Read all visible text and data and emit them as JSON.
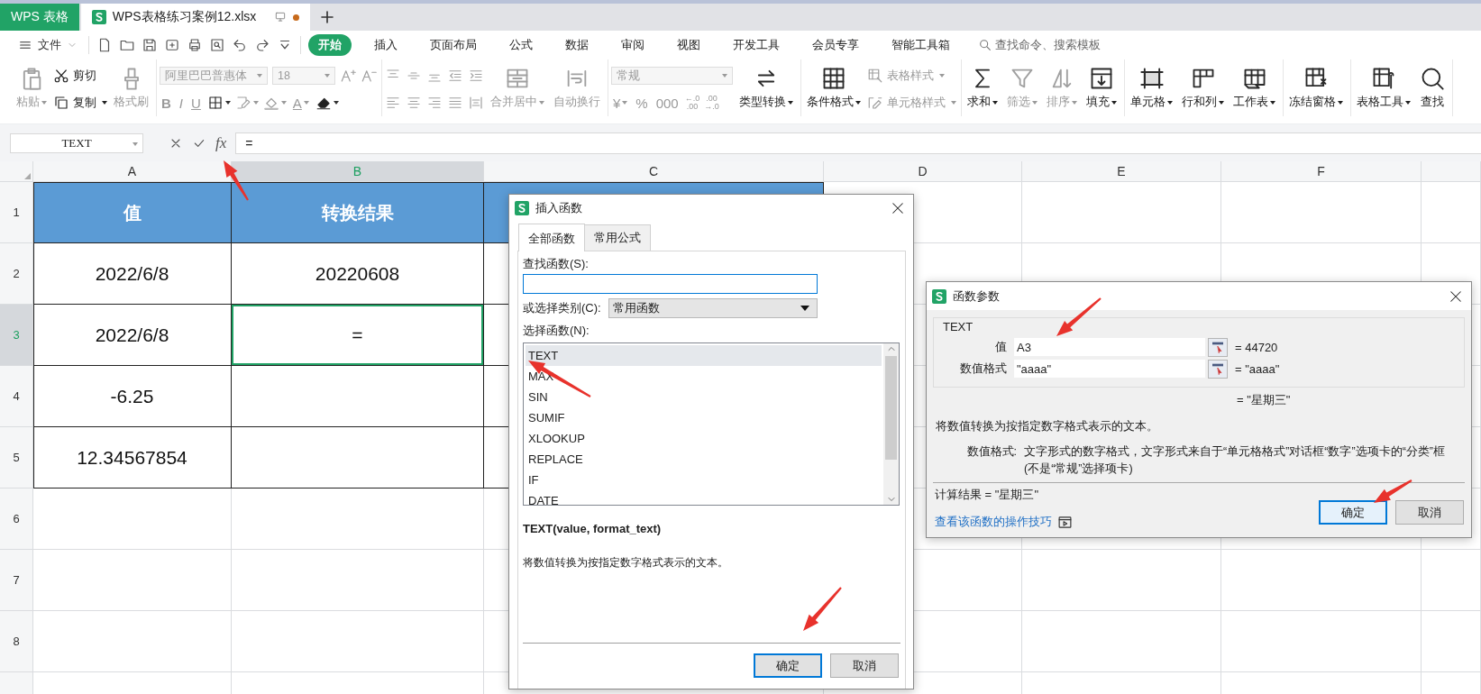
{
  "app_tabs": [
    {
      "label": "WPS 表格",
      "kind": "home",
      "selected": false
    },
    {
      "label": "WPS表格练习案例12.xlsx",
      "kind": "document",
      "selected": true,
      "unsaved": true
    }
  ],
  "menu": {
    "file": "文件",
    "tabs": [
      {
        "label": "开始",
        "selected": true
      },
      {
        "label": "插入",
        "selected": false
      },
      {
        "label": "页面布局",
        "selected": false
      },
      {
        "label": "公式",
        "selected": false
      },
      {
        "label": "数据",
        "selected": false
      },
      {
        "label": "审阅",
        "selected": false
      },
      {
        "label": "视图",
        "selected": false
      },
      {
        "label": "开发工具",
        "selected": false
      },
      {
        "label": "会员专享",
        "selected": false
      },
      {
        "label": "智能工具箱",
        "selected": false
      }
    ],
    "search_placeholder": "查找命令、搜索模板"
  },
  "ribbon": {
    "groups": [
      {
        "items": [
          {
            "kind": "large",
            "label": "粘贴",
            "disabled": true,
            "dropdown": true
          },
          {
            "kind": "stack",
            "top": [
              {
                "kind": "small",
                "label": "剪切",
                "disabled": false
              }
            ],
            "bottom": [
              {
                "kind": "small",
                "label": "复制",
                "disabled": false,
                "dropdown": true
              }
            ]
          },
          {
            "kind": "large",
            "label": "格式刷",
            "disabled": true
          }
        ]
      },
      {
        "items": [
          {
            "kind": "stack",
            "top": [
              {
                "kind": "combo",
                "value": "阿里巴巴普惠体",
                "disabled": true
              },
              {
                "kind": "combo",
                "value": "18",
                "disabled": true
              },
              {
                "kind": "icon",
                "disabled": true
              },
              {
                "kind": "icon",
                "disabled": true
              }
            ],
            "bottom": [
              {
                "kind": "glyph",
                "label": "B",
                "disabled": true
              },
              {
                "kind": "glyph",
                "label": "I",
                "disabled": true
              },
              {
                "kind": "glyph",
                "label": "U",
                "disabled": true
              },
              {
                "kind": "icon",
                "disabled": false,
                "dropdown": true
              },
              {
                "kind": "icon",
                "disabled": true,
                "dropdown": true
              },
              {
                "kind": "icon",
                "disabled": true,
                "dropdown": true
              },
              {
                "kind": "glyph",
                "label": "A",
                "disabled": true,
                "dropdown": true
              },
              {
                "kind": "icon",
                "disabled": false,
                "dropdown": true
              }
            ]
          }
        ]
      },
      {
        "items": [
          {
            "kind": "stack",
            "top": [
              {
                "kind": "icon",
                "disabled": true
              },
              {
                "kind": "icon",
                "disabled": true
              },
              {
                "kind": "icon",
                "disabled": true
              },
              {
                "kind": "icon",
                "disabled": true
              },
              {
                "kind": "icon",
                "disabled": true
              }
            ],
            "bottom": [
              {
                "kind": "icon",
                "disabled": true
              },
              {
                "kind": "icon",
                "disabled": true
              },
              {
                "kind": "icon",
                "disabled": true
              },
              {
                "kind": "icon",
                "disabled": true
              },
              {
                "kind": "icon",
                "disabled": true
              }
            ]
          },
          {
            "kind": "large",
            "label": "合并居中",
            "disabled": true,
            "dropdown": true
          },
          {
            "kind": "large",
            "label": "自动换行",
            "disabled": true
          }
        ]
      },
      {
        "items": [
          {
            "kind": "stack",
            "top": [
              {
                "kind": "combo",
                "value": "常规",
                "disabled": true
              }
            ],
            "bottom": [
              {
                "kind": "glyph",
                "label": "¥",
                "disabled": true,
                "dropdown": true
              },
              {
                "kind": "glyph",
                "label": "%",
                "disabled": true
              },
              {
                "kind": "glyph",
                "label": "000",
                "disabled": true
              },
              {
                "kind": "glyph2",
                "top": "←.0",
                "bottom": ".00",
                "disabled": true
              },
              {
                "kind": "glyph2",
                "top": ".00",
                "bottom": "→.0",
                "disabled": true
              }
            ]
          },
          {
            "kind": "large",
            "label": "类型转换",
            "disabled": false,
            "dropdown": true
          }
        ]
      },
      {
        "items": [
          {
            "kind": "large",
            "label": "条件格式",
            "disabled": false,
            "dropdown": true
          },
          {
            "kind": "stack",
            "top": [
              {
                "kind": "small",
                "label": "表格样式",
                "disabled": true,
                "dropdown": true
              }
            ],
            "bottom": [
              {
                "kind": "small",
                "label": "单元格样式",
                "disabled": true,
                "dropdown": true
              }
            ]
          }
        ]
      },
      {
        "items": [
          {
            "kind": "large",
            "label": "求和",
            "disabled": false,
            "dropdown": true
          },
          {
            "kind": "large",
            "label": "筛选",
            "disabled": true,
            "dropdown": true
          },
          {
            "kind": "large",
            "label": "排序",
            "disabled": true,
            "dropdown": true
          },
          {
            "kind": "large",
            "label": "填充",
            "disabled": false,
            "dropdown": true
          }
        ]
      },
      {
        "items": [
          {
            "kind": "large",
            "label": "单元格",
            "disabled": false,
            "dropdown": true
          },
          {
            "kind": "large",
            "label": "行和列",
            "disabled": false,
            "dropdown": true
          },
          {
            "kind": "large",
            "label": "工作表",
            "disabled": false,
            "dropdown": true
          }
        ]
      },
      {
        "items": [
          {
            "kind": "large",
            "label": "冻结窗格",
            "disabled": false,
            "dropdown": true
          }
        ]
      },
      {
        "items": [
          {
            "kind": "large",
            "label": "表格工具",
            "disabled": false,
            "dropdown": true
          },
          {
            "kind": "large",
            "label": "查找",
            "disabled": false
          }
        ]
      }
    ]
  },
  "formula_bar": {
    "name_box": "TEXT",
    "function_button": "fx",
    "formula": "="
  },
  "sheet": {
    "columns": [
      {
        "label": "A",
        "selected": false
      },
      {
        "label": "B",
        "selected": true
      },
      {
        "label": "C",
        "selected": false
      },
      {
        "label": "D",
        "selected": false
      },
      {
        "label": "E",
        "selected": false
      },
      {
        "label": "F",
        "selected": false
      }
    ],
    "rows": [
      {
        "header": "1",
        "selected": false,
        "kind": "table-header",
        "cells": [
          {
            "text": "值",
            "selected": false
          },
          {
            "text": "转换结果",
            "selected": false
          },
          {
            "text": "",
            "selected": false
          }
        ]
      },
      {
        "header": "2",
        "selected": false,
        "kind": "table-row",
        "cells": [
          {
            "text": "2022/6/8",
            "selected": false
          },
          {
            "text": "20220608",
            "selected": false
          },
          {
            "text": "",
            "selected": false
          }
        ]
      },
      {
        "header": "3",
        "selected": true,
        "kind": "table-row",
        "cells": [
          {
            "text": "2022/6/8",
            "selected": false
          },
          {
            "text": "=",
            "selected": true
          },
          {
            "text": "",
            "selected": false
          }
        ]
      },
      {
        "header": "4",
        "selected": false,
        "kind": "table-row",
        "cells": [
          {
            "text": "-6.25",
            "selected": false
          },
          {
            "text": "",
            "selected": false
          },
          {
            "text": "",
            "selected": false
          }
        ]
      },
      {
        "header": "5",
        "selected": false,
        "kind": "table-row",
        "cells": [
          {
            "text": "12.34567854",
            "selected": false
          },
          {
            "text": "",
            "selected": false
          },
          {
            "text": "",
            "selected": false
          }
        ]
      },
      {
        "header": "6",
        "selected": false,
        "kind": "empty"
      },
      {
        "header": "7",
        "selected": false,
        "kind": "empty"
      },
      {
        "header": "8",
        "selected": false,
        "kind": "empty"
      }
    ]
  },
  "insert_function_dialog": {
    "title": "插入函数",
    "tabs": [
      {
        "label": "全部函数",
        "selected": true
      },
      {
        "label": "常用公式",
        "selected": false
      }
    ],
    "search_label": "查找函数(S):",
    "category_label": "或选择类别(C):",
    "category": "常用函数",
    "list_label": "选择函数(N):",
    "functions": [
      {
        "name": "TEXT",
        "selected": true
      },
      {
        "name": "MAX",
        "selected": false
      },
      {
        "name": "SIN",
        "selected": false
      },
      {
        "name": "SUMIF",
        "selected": false
      },
      {
        "name": "XLOOKUP",
        "selected": false
      },
      {
        "name": "REPLACE",
        "selected": false
      },
      {
        "name": "IF",
        "selected": false
      },
      {
        "name": "DATE",
        "selected": false
      }
    ],
    "signature": "TEXT(value, format_text)",
    "description": "将数值转换为按指定数字格式表示的文本。",
    "buttons": [
      {
        "label": "确定",
        "default": true
      },
      {
        "label": "取消",
        "default": false
      }
    ]
  },
  "function_args_dialog": {
    "title": "函数参数",
    "function": "TEXT",
    "args": [
      {
        "label": "值",
        "value": "A3",
        "result": "= 44720"
      },
      {
        "label": "数值格式",
        "value": "\"aaaa\"",
        "result": "= \"aaaa\""
      }
    ],
    "result": "= \"星期三\"",
    "description": "将数值转换为按指定数字格式表示的文本。",
    "param_label": "数值格式:",
    "param_help": "文字形式的数字格式，文字形式来自于“单元格格式”对话框“数字”选项卡的“分类”框(不是“常规”选择项卡)",
    "computed": "计算结果 = \"星期三\"",
    "help_link": "查看该函数的操作技巧",
    "buttons": [
      {
        "label": "确定",
        "default": true
      },
      {
        "label": "取消",
        "default": false
      }
    ]
  }
}
